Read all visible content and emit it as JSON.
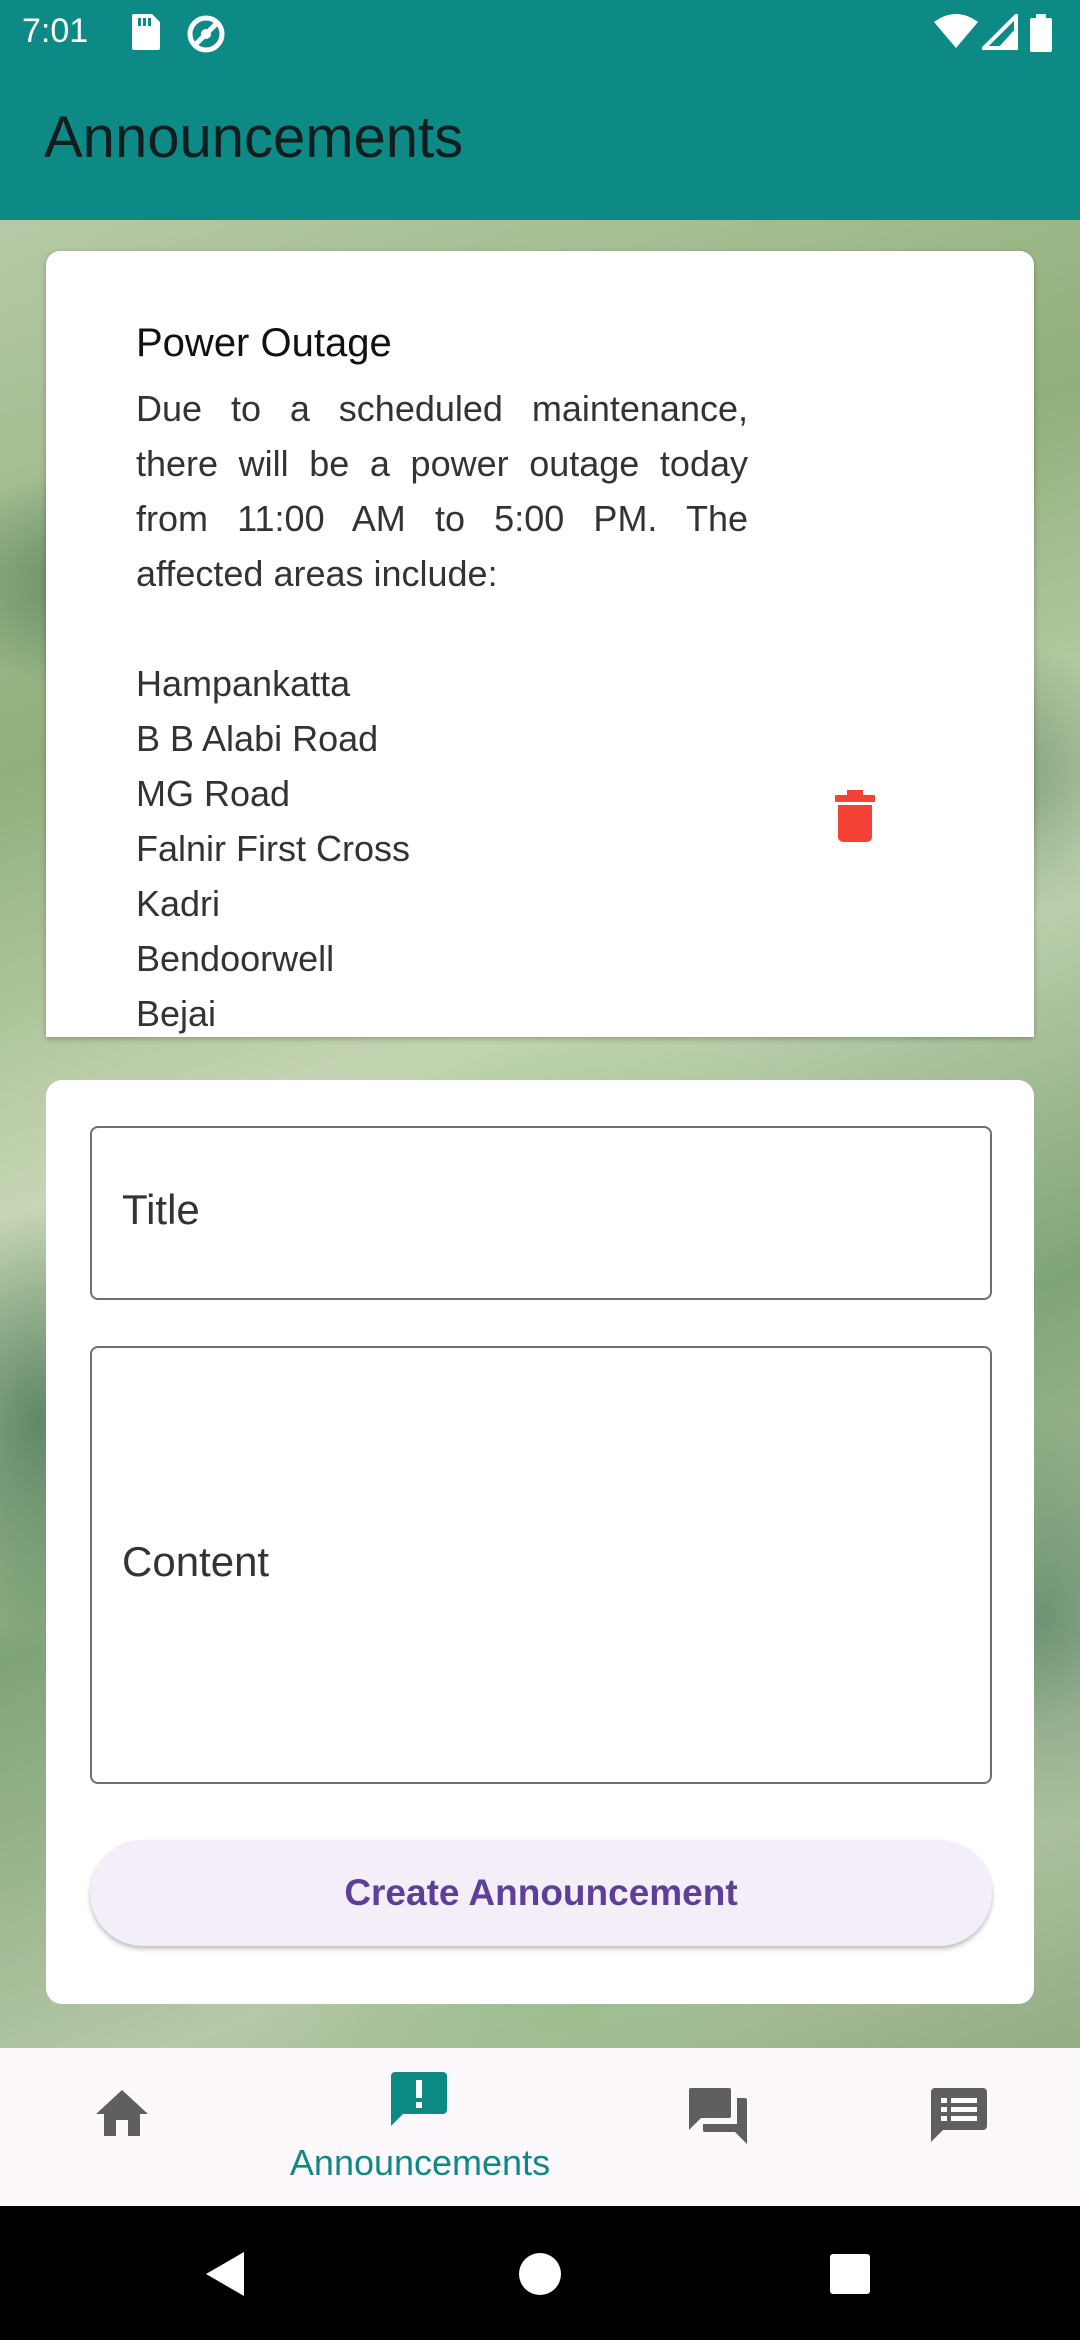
{
  "status_bar": {
    "time": "7:01",
    "left_icons": [
      "sd-card-icon",
      "no-disturb-icon"
    ],
    "right_icons": [
      "wifi-icon",
      "cellular-signal-icon",
      "battery-icon"
    ]
  },
  "app_bar": {
    "title": "Announcements"
  },
  "announcement": {
    "title": "Power Outage",
    "body": "Due to a scheduled maintenance, there will be a power outage today from 11:00 AM to 5:00 PM. The affected areas include:\n\nHampankatta\nB B Alabi Road\nMG Road\nFalnir First Cross\nKadri\nBendoorwell\nBejai",
    "delete_icon": "trash-icon",
    "delete_color": "#f44336"
  },
  "form": {
    "title_label": "Title",
    "content_label": "Content",
    "submit_label": "Create Announcement"
  },
  "bottom_nav": {
    "items": [
      {
        "icon": "home-icon",
        "label": ""
      },
      {
        "icon": "announcement-icon",
        "label": "Announcements",
        "active": true
      },
      {
        "icon": "forum-icon",
        "label": ""
      },
      {
        "icon": "feedback-icon",
        "label": ""
      }
    ],
    "active_color": "#0d8a86",
    "inactive_color": "#5f5f5f"
  },
  "system_nav": {
    "buttons": [
      "back-icon",
      "home-circle-icon",
      "recents-icon"
    ]
  },
  "colors": {
    "primary": "#0d8a86",
    "button_text": "#5d3f9a",
    "button_bg": "#f3eef8"
  }
}
